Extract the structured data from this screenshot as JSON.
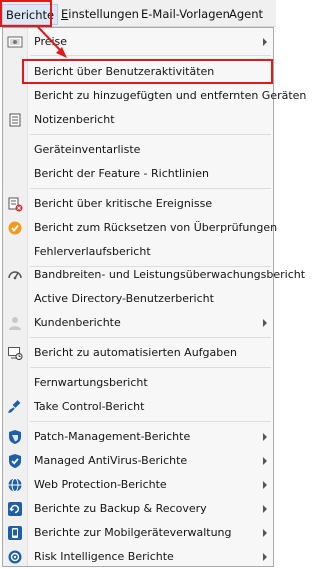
{
  "menubar": {
    "items": [
      {
        "label": "Berichte",
        "active": true
      },
      {
        "label": "Einstellungen",
        "underline": "E"
      },
      {
        "label": "E-Mail-Vorlagen"
      },
      {
        "label": "Agent"
      }
    ]
  },
  "menu": {
    "items": [
      {
        "label": "Preise",
        "icon": "price-list-icon",
        "submenu": true
      },
      {
        "label": "Bericht über Benutzeraktivitäten",
        "highlighted": true
      },
      {
        "label": "Bericht zu hinzugefügten und entfernten Geräten"
      },
      {
        "label": "Notizenbericht",
        "icon": "notes-icon"
      },
      {
        "label": "Geräteinventarliste"
      },
      {
        "label": "Bericht der Feature - Richtlinien"
      },
      {
        "label": "Bericht über kritische Ereignisse",
        "icon": "critical-events-icon"
      },
      {
        "label": "Bericht zum Rücksetzen von Überprüfungen",
        "icon": "check-reset-icon"
      },
      {
        "label": "Fehlerverlaufsbericht"
      },
      {
        "label": "Bandbreiten- und Leistungsüberwachungsbericht",
        "icon": "gauge-icon"
      },
      {
        "label": "Active Directory-Benutzerbericht"
      },
      {
        "label": "Kundenberichte",
        "icon": "user-icon",
        "submenu": true
      },
      {
        "label": "Bericht zu automatisierten Aufgaben",
        "icon": "automation-icon"
      },
      {
        "label": "Fernwartungsbericht"
      },
      {
        "label": "Take Control-Bericht",
        "icon": "satellite-icon"
      },
      {
        "label": "Patch-Management-Berichte",
        "icon": "shield-icon",
        "submenu": true
      },
      {
        "label": "Managed AntiVirus-Berichte",
        "icon": "antivirus-shield-icon",
        "submenu": true
      },
      {
        "label": "Web Protection-Berichte",
        "icon": "globe-icon",
        "submenu": true
      },
      {
        "label": "Berichte zu Backup & Recovery",
        "icon": "backup-icon",
        "submenu": true
      },
      {
        "label": "Berichte zur Mobilgeräteverwaltung",
        "icon": "mobile-device-icon",
        "submenu": true
      },
      {
        "label": "Risk Intelligence Berichte",
        "icon": "risk-intelligence-icon",
        "submenu": true
      }
    ]
  },
  "colors": {
    "highlight_border": "#e01a1a",
    "shield_blue": "#1f5fa8",
    "check_orange": "#f29b1d"
  }
}
